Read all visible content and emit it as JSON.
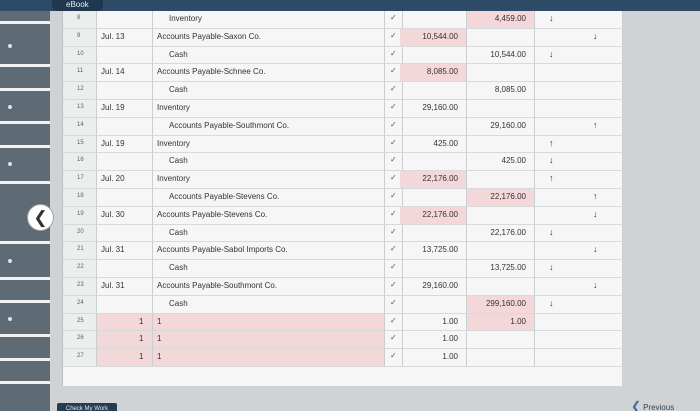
{
  "header": {
    "ebook_label": "eBook"
  },
  "rows": [
    {
      "num": "8",
      "date": "",
      "account": "Inventory",
      "indent": true,
      "debit": "",
      "credit": "4,459.00",
      "credit_pink": true,
      "arrow1": "↓",
      "arrow2": ""
    },
    {
      "num": "9",
      "date": "Jul. 13",
      "account": "Accounts Payable-Saxon Co.",
      "indent": false,
      "debit": "10,544.00",
      "debit_pink": true,
      "credit": "",
      "arrow1": "",
      "arrow2": "↓"
    },
    {
      "num": "10",
      "date": "",
      "account": "Cash",
      "indent": true,
      "debit": "",
      "credit": "10,544.00",
      "arrow1": "↓",
      "arrow2": ""
    },
    {
      "num": "11",
      "date": "Jul. 14",
      "account": "Accounts Payable-Schnee Co.",
      "indent": false,
      "debit": "8,085.00",
      "debit_pink": true,
      "credit": "",
      "arrow1": "",
      "arrow2": ""
    },
    {
      "num": "12",
      "date": "",
      "account": "Cash",
      "indent": true,
      "debit": "",
      "credit": "8,085.00",
      "arrow1": "",
      "arrow2": ""
    },
    {
      "num": "13",
      "date": "Jul. 19",
      "account": "Inventory",
      "indent": false,
      "debit": "29,160.00",
      "credit": "",
      "arrow1": "",
      "arrow2": ""
    },
    {
      "num": "14",
      "date": "",
      "account": "Accounts Payable-Southmont Co.",
      "indent": true,
      "debit": "",
      "credit": "29,160.00",
      "arrow1": "",
      "arrow2": "↑"
    },
    {
      "num": "15",
      "date": "Jul. 19",
      "account": "Inventory",
      "indent": false,
      "debit": "425.00",
      "credit": "",
      "arrow1": "↑",
      "arrow2": ""
    },
    {
      "num": "16",
      "date": "",
      "account": "Cash",
      "indent": true,
      "debit": "",
      "credit": "425.00",
      "arrow1": "↓",
      "arrow2": ""
    },
    {
      "num": "17",
      "date": "Jul. 20",
      "account": "Inventory",
      "indent": false,
      "debit": "22,176.00",
      "debit_pink": true,
      "credit": "",
      "arrow1": "↑",
      "arrow2": ""
    },
    {
      "num": "18",
      "date": "",
      "account": "Accounts Payable-Stevens Co.",
      "indent": true,
      "debit": "",
      "credit": "22,176.00",
      "credit_pink": true,
      "arrow1": "",
      "arrow2": "↑"
    },
    {
      "num": "19",
      "date": "Jul. 30",
      "account": "Accounts Payable-Stevens Co.",
      "indent": false,
      "debit": "22,176.00",
      "debit_pink": true,
      "credit": "",
      "arrow1": "",
      "arrow2": "↓"
    },
    {
      "num": "20",
      "date": "",
      "account": "Cash",
      "indent": true,
      "debit": "",
      "credit": "22,176.00",
      "arrow1": "↓",
      "arrow2": ""
    },
    {
      "num": "21",
      "date": "Jul. 31",
      "account": "Accounts Payable-Sabol Imports Co.",
      "indent": false,
      "debit": "13,725.00",
      "credit": "",
      "arrow1": "",
      "arrow2": "↓"
    },
    {
      "num": "22",
      "date": "",
      "account": "Cash",
      "indent": true,
      "debit": "",
      "credit": "13,725.00",
      "arrow1": "↓",
      "arrow2": ""
    },
    {
      "num": "23",
      "date": "Jul. 31",
      "account": "Accounts Payable-Southmont Co.",
      "indent": false,
      "debit": "29,160.00",
      "credit": "",
      "arrow1": "",
      "arrow2": "↓"
    },
    {
      "num": "24",
      "date": "",
      "account": "Cash",
      "indent": true,
      "debit": "",
      "credit": "299,160.00",
      "credit_pink": true,
      "arrow1": "↓",
      "arrow2": ""
    },
    {
      "num": "25",
      "date": "1",
      "account": "1",
      "indent": false,
      "pink_row": true,
      "debit": "1.00",
      "credit": "1.00",
      "credit_pink": true,
      "arrow1": "",
      "arrow2": ""
    },
    {
      "num": "26",
      "date": "1",
      "account": "1",
      "indent": false,
      "pink_row": true,
      "debit": "1.00",
      "credit": "",
      "arrow1": "",
      "arrow2": ""
    },
    {
      "num": "27",
      "date": "1",
      "account": "1",
      "indent": false,
      "pink_row": true,
      "debit": "1.00",
      "credit": "",
      "arrow1": "",
      "arrow2": ""
    }
  ],
  "footer": {
    "check_label": "Check My Work",
    "previous_label": "Previous"
  }
}
